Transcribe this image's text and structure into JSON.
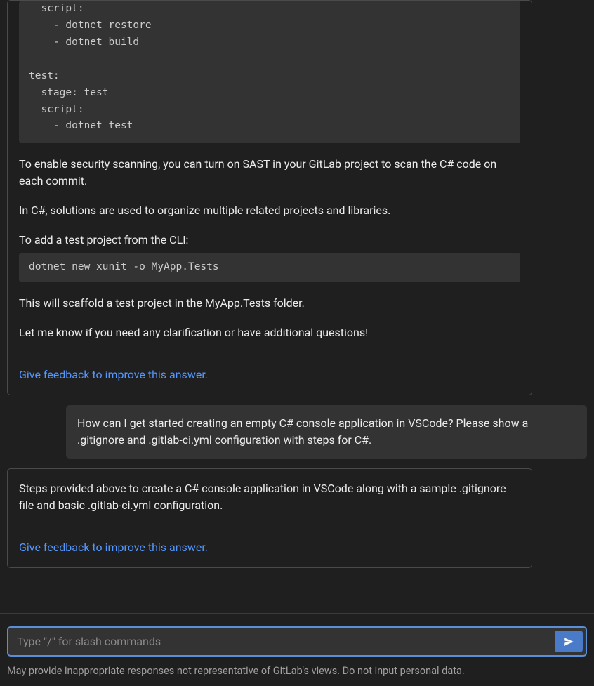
{
  "conversation": {
    "msg1": {
      "code1": "  script:\n    - dotnet restore\n    - dotnet build\n\ntest:\n  stage: test\n  script:\n    - dotnet test",
      "p1": "To enable security scanning, you can turn on SAST in your GitLab project to scan the C# code on each commit.",
      "p2": "In C#, solutions are used to organize multiple related projects and libraries.",
      "p3": "To add a test project from the CLI:",
      "code2": "dotnet new xunit -o MyApp.Tests",
      "p4": "This will scaffold a test project in the MyApp.Tests folder.",
      "p5": "Let me know if you need any clarification or have additional questions!",
      "feedback": "Give feedback to improve this answer."
    },
    "user1": {
      "text": "How can I get started creating an empty C# console application in VSCode? Please show a .gitignore and .gitlab-ci.yml configuration with steps for C#."
    },
    "msg2": {
      "p1": "Steps provided above to create a C# console application in VSCode along with a sample .gitignore file and basic .gitlab-ci.yml configuration.",
      "feedback": "Give feedback to improve this answer."
    }
  },
  "input": {
    "placeholder": "Type \"/\" for slash commands"
  },
  "disclaimer": "May provide inappropriate responses not representative of GitLab's views. Do not input personal data."
}
